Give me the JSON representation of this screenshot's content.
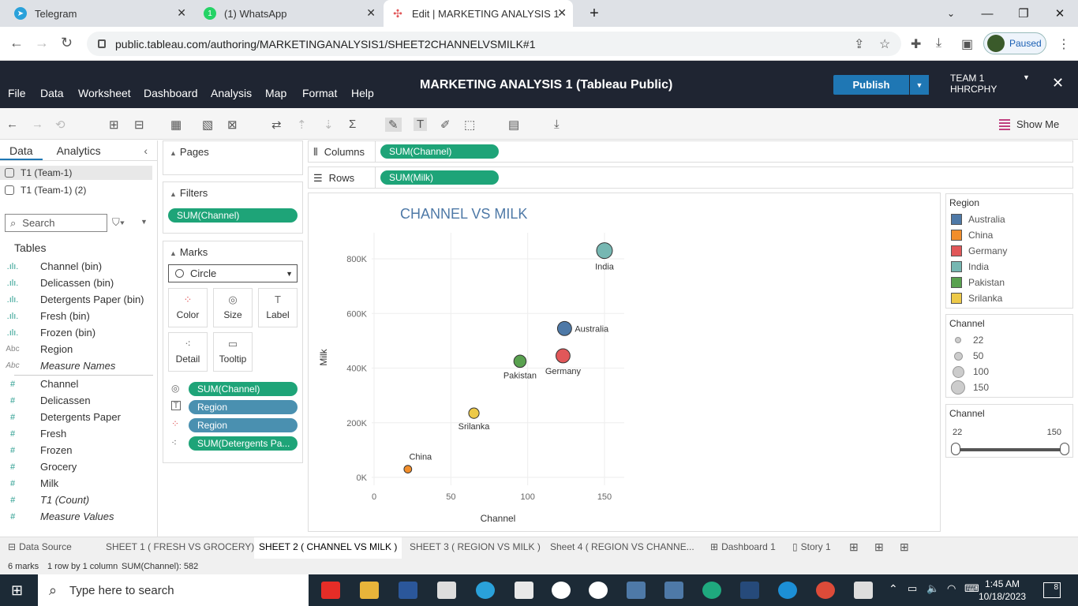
{
  "browser": {
    "tabs": [
      {
        "title": "Telegram",
        "icon": "telegram-icon",
        "color": "#2aa1da"
      },
      {
        "title": "(1) WhatsApp",
        "icon": "whatsapp-icon",
        "color": "#25d366"
      },
      {
        "title": "Edit | MARKETING ANALYSIS 1",
        "icon": "tableau-icon",
        "color": "#e15759"
      }
    ],
    "url": "public.tableau.com/authoring/MARKETINGANALYSIS1/SHEET2CHANNELVSMILK#1",
    "profile_status": "Paused"
  },
  "app": {
    "menu": [
      "File",
      "Data",
      "Worksheet",
      "Dashboard",
      "Analysis",
      "Map",
      "Format",
      "Help"
    ],
    "title": "MARKETING ANALYSIS 1 (Tableau Public)",
    "publish_label": "Publish",
    "team_line1": "TEAM 1",
    "team_line2": "HHRCPHY",
    "show_me": "Show Me"
  },
  "data_pane": {
    "tab_data": "Data",
    "tab_analytics": "Analytics",
    "sources": [
      "T1 (Team-1)",
      "T1 (Team-1) (2)"
    ],
    "search_placeholder": "Search",
    "tables_header": "Tables",
    "dimensions": [
      {
        "name": "Channel (bin)",
        "type": "bin"
      },
      {
        "name": "Delicassen (bin)",
        "type": "bin"
      },
      {
        "name": "Detergents Paper (bin)",
        "type": "bin"
      },
      {
        "name": "Fresh (bin)",
        "type": "bin"
      },
      {
        "name": "Frozen (bin)",
        "type": "bin"
      },
      {
        "name": "Region",
        "type": "abc"
      },
      {
        "name": "Measure Names",
        "type": "abc",
        "italic": true
      }
    ],
    "measures": [
      {
        "name": "Channel"
      },
      {
        "name": "Delicassen"
      },
      {
        "name": "Detergents Paper"
      },
      {
        "name": "Fresh"
      },
      {
        "name": "Frozen"
      },
      {
        "name": "Grocery"
      },
      {
        "name": "Milk"
      },
      {
        "name": "T1 (Count)",
        "italic": true
      },
      {
        "name": "Measure Values",
        "italic": true
      }
    ]
  },
  "cards": {
    "pages": "Pages",
    "filters": "Filters",
    "filter_pill": "SUM(Channel)",
    "marks": "Marks",
    "mark_type": "Circle",
    "mark_buttons": [
      "Color",
      "Size",
      "Label",
      "Detail",
      "Tooltip"
    ],
    "mark_pills": [
      {
        "label": "SUM(Channel)",
        "kind": "size",
        "color": "green"
      },
      {
        "label": "Region",
        "kind": "label",
        "color": "blue"
      },
      {
        "label": "Region",
        "kind": "color",
        "color": "blue"
      },
      {
        "label": "SUM(Detergents Pa...",
        "kind": "detail",
        "color": "green"
      }
    ]
  },
  "shelves": {
    "columns_label": "Columns",
    "columns_pill": "SUM(Channel)",
    "rows_label": "Rows",
    "rows_pill": "SUM(Milk)"
  },
  "chart_data": {
    "type": "scatter",
    "title": "CHANNEL VS MILK",
    "xlabel": "Channel",
    "ylabel": "Milk",
    "xlim": [
      0,
      150
    ],
    "ylim": [
      0,
      800000
    ],
    "x_ticks": [
      0,
      50,
      100,
      150
    ],
    "y_ticks": [
      "0K",
      "200K",
      "400K",
      "600K",
      "800K"
    ],
    "points": [
      {
        "label": "India",
        "x": 150,
        "y": 830000,
        "color": "#76b7b2"
      },
      {
        "label": "Australia",
        "x": 124,
        "y": 545000,
        "color": "#4e79a7"
      },
      {
        "label": "Germany",
        "x": 123,
        "y": 445000,
        "color": "#e15759"
      },
      {
        "label": "Pakistan",
        "x": 95,
        "y": 425000,
        "color": "#59a14f"
      },
      {
        "label": "Srilanka",
        "x": 65,
        "y": 235000,
        "color": "#edc948"
      },
      {
        "label": "China",
        "x": 22,
        "y": 30000,
        "color": "#f28e2b"
      }
    ]
  },
  "legends": {
    "region_title": "Region",
    "regions": [
      {
        "name": "Australia",
        "color": "#4e79a7"
      },
      {
        "name": "China",
        "color": "#f28e2b"
      },
      {
        "name": "Germany",
        "color": "#e15759"
      },
      {
        "name": "India",
        "color": "#76b7b2"
      },
      {
        "name": "Pakistan",
        "color": "#59a14f"
      },
      {
        "name": "Srilanka",
        "color": "#edc948"
      }
    ],
    "size_title": "Channel",
    "sizes": [
      "22",
      "50",
      "100",
      "150"
    ],
    "filter_title": "Channel",
    "filter_min": "22",
    "filter_max": "150"
  },
  "sheet_tabs": [
    "Data Source",
    "SHEET 1 ( FRESH VS GROCERY)",
    "SHEET 2 ( CHANNEL VS MILK )",
    "SHEET 3 ( REGION VS MILK )",
    "Sheet 4 ( REGION VS CHANNE...",
    "Dashboard 1",
    "Story 1"
  ],
  "status": {
    "marks": "6 marks",
    "dims": "1 row by 1 column",
    "sum": "SUM(Channel): 582"
  },
  "taskbar": {
    "search_placeholder": "Type here to search",
    "time": "1:45 AM",
    "date": "10/18/2023",
    "notif_count": "8"
  }
}
